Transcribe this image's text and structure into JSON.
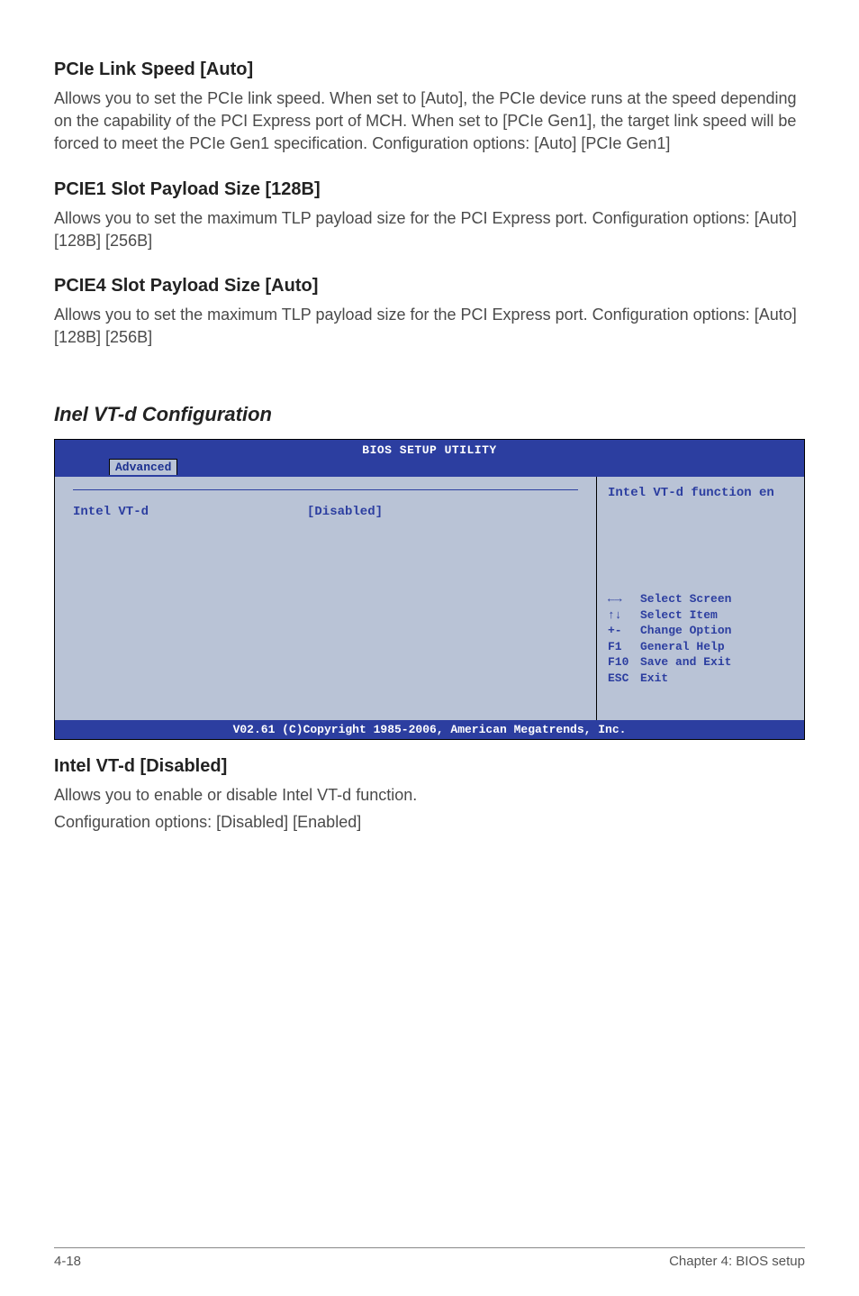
{
  "sections": {
    "pcie_link_speed": {
      "heading": "PCIe Link Speed [Auto]",
      "body": "Allows you to set the PCIe link speed. When set to [Auto], the PCIe device runs at the speed depending on the capability of the PCI Express port of MCH. When set to [PCIe Gen1], the target link speed will be forced to meet the PCIe Gen1 specification. Configuration options: [Auto] [PCIe Gen1]"
    },
    "pcie1_slot": {
      "heading": "PCIE1 Slot Payload Size [128B]",
      "body": "Allows you to set the maximum TLP payload size for the PCI Express port. Configuration options: [Auto] [128B] [256B]"
    },
    "pcie4_slot": {
      "heading": "PCIE4 Slot Payload Size [Auto]",
      "body": "Allows you to set the maximum TLP payload size for the PCI Express port. Configuration options: [Auto] [128B] [256B]"
    }
  },
  "config_heading": "Inel VT-d Configuration",
  "bios": {
    "title": "BIOS SETUP UTILITY",
    "tab": "Advanced",
    "setting_label": "Intel VT-d",
    "setting_value": "[Disabled]",
    "help_text": "Intel VT-d function en",
    "nav": [
      {
        "key": "←→",
        "label": "Select Screen"
      },
      {
        "key": "↑↓",
        "label": "Select Item"
      },
      {
        "key": "+-",
        "label": "Change Option"
      },
      {
        "key": "F1",
        "label": "General Help"
      },
      {
        "key": "F10",
        "label": "Save and Exit"
      },
      {
        "key": "ESC",
        "label": "Exit"
      }
    ],
    "footer": "V02.61 (C)Copyright 1985-2006, American Megatrends, Inc."
  },
  "intel_vtd": {
    "heading": "Intel VT-d [Disabled]",
    "body1": "Allows you to enable or disable Intel VT-d function.",
    "body2": "Configuration options: [Disabled] [Enabled]"
  },
  "footer": {
    "page": "4-18",
    "chapter": "Chapter 4: BIOS setup"
  }
}
